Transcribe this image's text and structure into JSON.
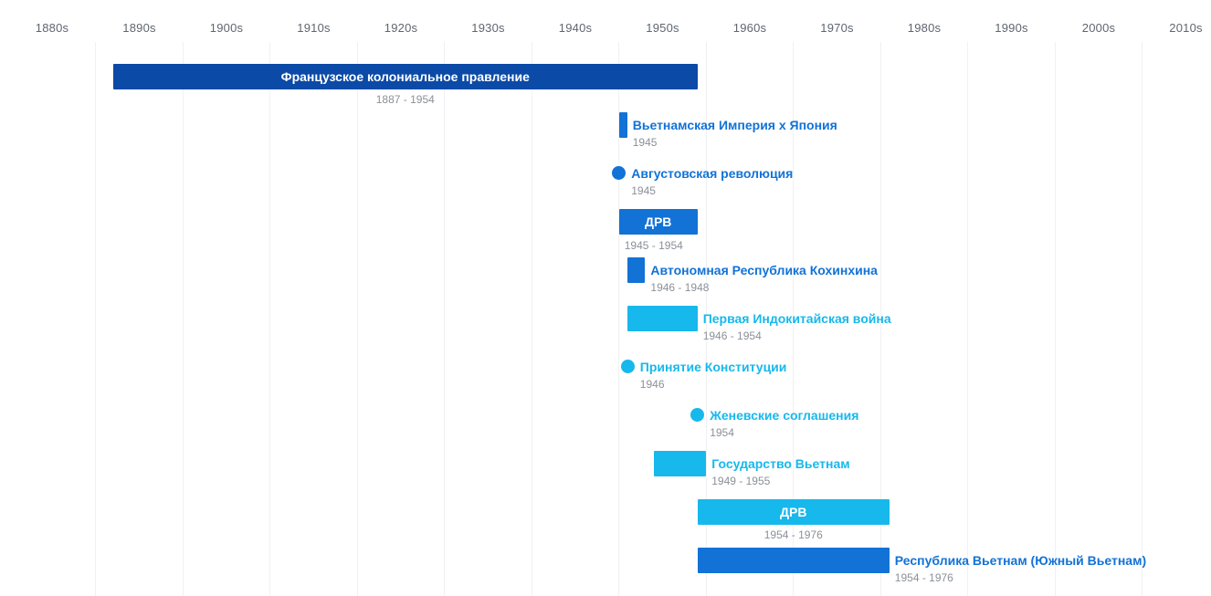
{
  "colors": {
    "dark": "#0b4aa6",
    "mid": "#1272d6",
    "light": "#17b8ec"
  },
  "axis": {
    "start_year": 1880,
    "end_year": 2010,
    "decades": [
      "1880s",
      "1890s",
      "1900s",
      "1910s",
      "1920s",
      "1930s",
      "1940s",
      "1950s",
      "1960s",
      "1970s",
      "1980s",
      "1990s",
      "2000s",
      "2010s"
    ]
  },
  "chart_data": {
    "type": "timeline",
    "events": [
      {
        "title": "Французское колониальное правление",
        "dates": "1887 - 1954",
        "start": 1887,
        "end": 1954,
        "kind": "bar",
        "color": "dark",
        "label_placement": "inside",
        "date_placement": "below-center"
      },
      {
        "title": "Вьетнамская Империя x Япония",
        "dates": "1945",
        "start": 1945,
        "end": 1945.1,
        "kind": "bar",
        "color": "mid",
        "label_placement": "right",
        "date_placement": "right"
      },
      {
        "title": "Августовская революция",
        "dates": "1945",
        "start": 1945,
        "end": 1945,
        "kind": "point",
        "color": "mid",
        "label_placement": "right",
        "date_placement": "right"
      },
      {
        "title": "ДРВ",
        "dates": "1945 - 1954",
        "start": 1945,
        "end": 1954,
        "kind": "bar",
        "color": "mid",
        "label_placement": "inside",
        "date_placement": "below-left"
      },
      {
        "title": "Автономная Республика Кохинхина",
        "dates": "1946 - 1948",
        "start": 1946,
        "end": 1948,
        "kind": "bar",
        "color": "mid",
        "label_placement": "right",
        "date_placement": "right"
      },
      {
        "title": "Первая Индокитайская война",
        "dates": "1946 - 1954",
        "start": 1946,
        "end": 1954,
        "kind": "bar",
        "color": "light",
        "label_placement": "right",
        "date_placement": "right"
      },
      {
        "title": "Принятие Конституции",
        "dates": "1946",
        "start": 1946,
        "end": 1946,
        "kind": "point",
        "color": "light",
        "label_placement": "right",
        "date_placement": "right"
      },
      {
        "title": "Женевские соглашения",
        "dates": "1954",
        "start": 1954,
        "end": 1954,
        "kind": "point",
        "color": "light",
        "label_placement": "right",
        "date_placement": "right"
      },
      {
        "title": "Государство Вьетнам",
        "dates": "1949 - 1955",
        "start": 1949,
        "end": 1955,
        "kind": "bar",
        "color": "light",
        "label_placement": "right",
        "date_placement": "right"
      },
      {
        "title": "ДРВ",
        "dates": "1954 - 1976",
        "start": 1954,
        "end": 1976,
        "kind": "bar",
        "color": "light",
        "label_placement": "inside",
        "date_placement": "below-center"
      },
      {
        "title": "Республика Вьетнам (Южный Вьетнам)",
        "dates": "1954 - 1976",
        "start": 1954,
        "end": 1976,
        "kind": "bar",
        "color": "mid",
        "label_placement": "right",
        "date_placement": "right"
      }
    ]
  }
}
